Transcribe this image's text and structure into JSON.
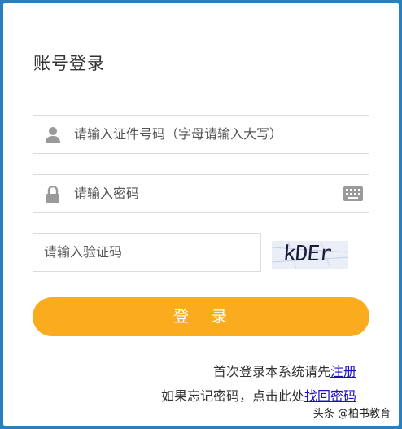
{
  "login": {
    "title": "账号登录",
    "id_placeholder": "请输入证件号码（字母请输入大写）",
    "password_placeholder": "请输入密码",
    "captcha_placeholder": "请输入验证码",
    "captcha_text": "kDEr",
    "submit_label": "登 录",
    "register_prompt": "首次登录本系统请先",
    "register_link": "注册",
    "forgot_prompt": "如果忘记密码，点击此处",
    "forgot_link": "找回密码"
  },
  "watermark": "头条 @柏书教育",
  "colors": {
    "background": "#2a7fbf",
    "button": "#fbac1e",
    "link": "#1a0dcc"
  },
  "icons": [
    "user-icon",
    "lock-icon",
    "keyboard-icon"
  ]
}
